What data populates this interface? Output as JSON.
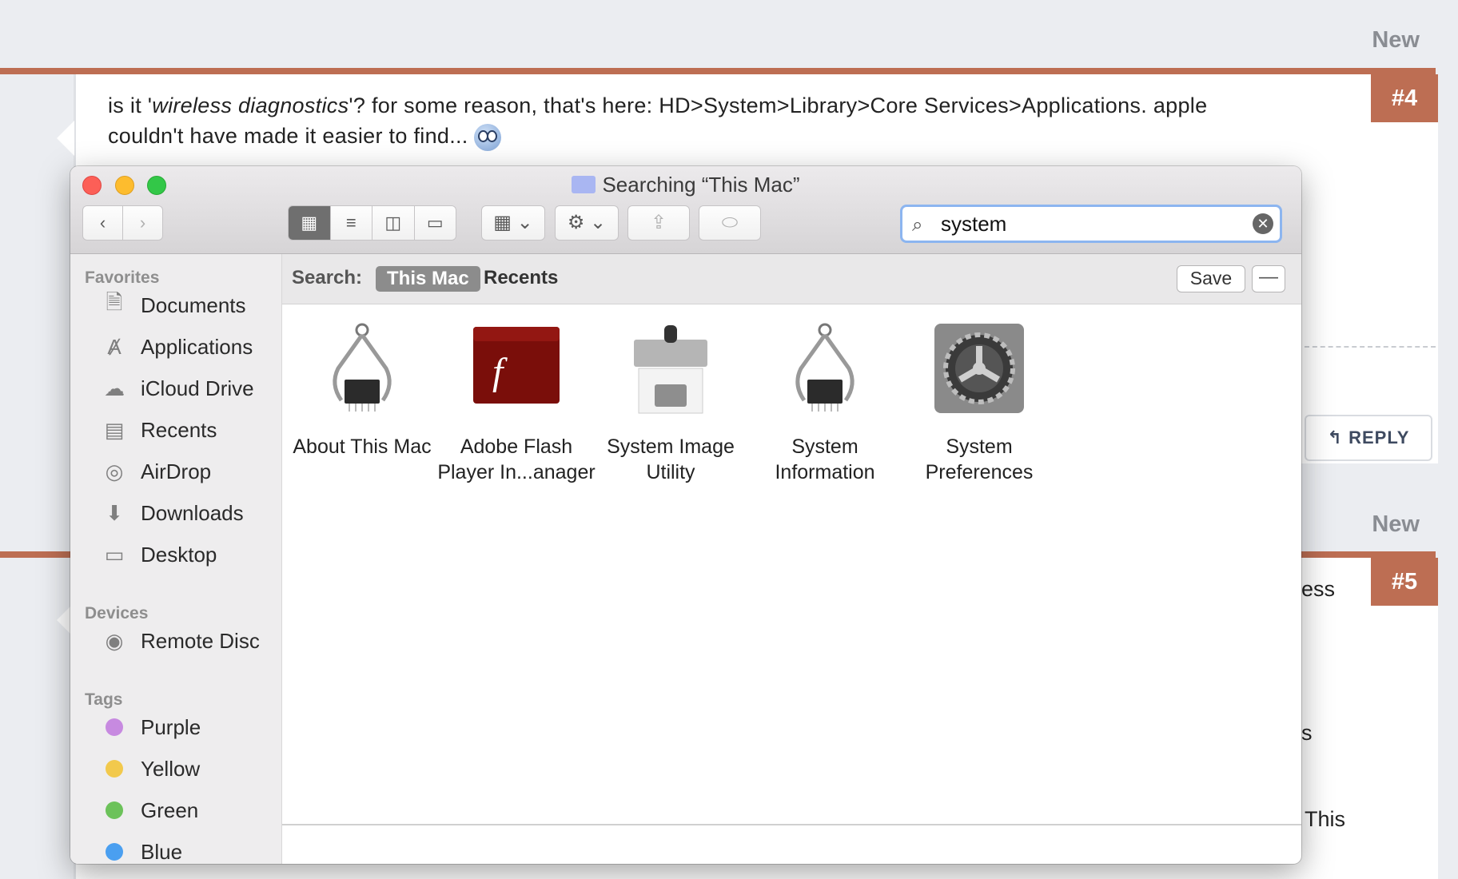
{
  "forum": {
    "post4": {
      "new_label": "New",
      "number": "#4",
      "text_before_italic": "is it '",
      "italic_text": "wireless diagnostics",
      "text_after_italic": "'? for some reason, that's here: HD>System>Library>Core Services>Applications. apple couldn't have made it easier to find... ",
      "reply_label": "REPLY"
    },
    "post5": {
      "new_label": "New",
      "number": "#5",
      "visible_fragments": [
        "ess",
        "s",
        "This"
      ]
    }
  },
  "finder": {
    "title": "Searching “This Mac”",
    "search": {
      "value": "system"
    },
    "scope": {
      "label": "Search:",
      "this_mac": "This Mac",
      "recents": "Recents",
      "save": "Save"
    },
    "sidebar": {
      "favorites_header": "Favorites",
      "favorites": [
        "Documents",
        "Applications",
        "iCloud Drive",
        "Recents",
        "AirDrop",
        "Downloads",
        "Desktop"
      ],
      "devices_header": "Devices",
      "devices": [
        "Remote Disc"
      ],
      "tags_header": "Tags",
      "tags": [
        {
          "name": "Purple",
          "color": "#c78ae0"
        },
        {
          "name": "Yellow",
          "color": "#f2c94c"
        },
        {
          "name": "Green",
          "color": "#6cc25a"
        },
        {
          "name": "Blue",
          "color": "#4a9ff0"
        }
      ]
    },
    "results": [
      {
        "line1": "About This Mac",
        "line2": ""
      },
      {
        "line1": "Adobe Flash",
        "line2": "Player In...anager"
      },
      {
        "line1": "System Image",
        "line2": "Utility"
      },
      {
        "line1": "System",
        "line2": "Information"
      },
      {
        "line1": "System",
        "line2": "Preferences"
      }
    ]
  }
}
